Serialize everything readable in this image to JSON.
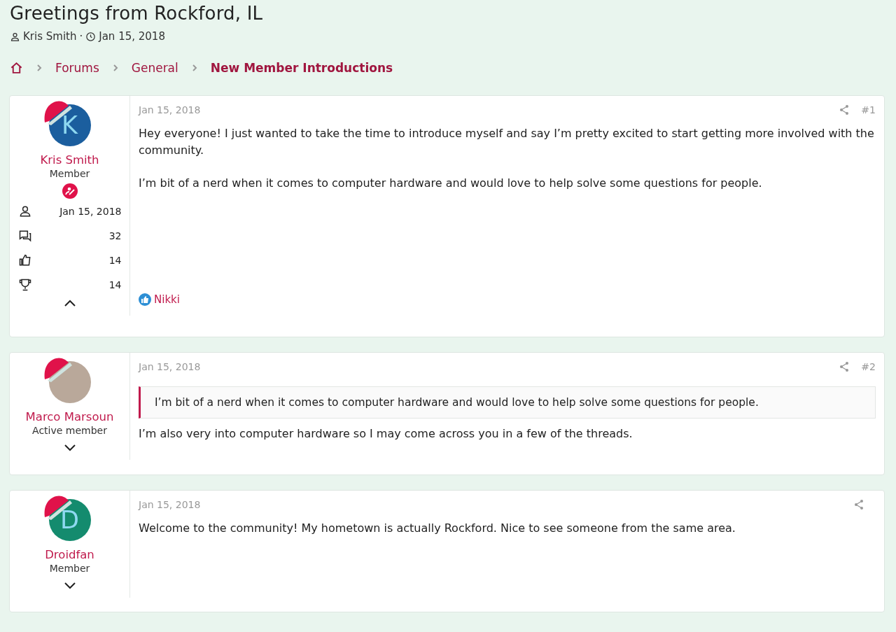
{
  "thread": {
    "title": "Greetings from Rockford, IL",
    "author": "Kris Smith",
    "separator": "·",
    "date": "Jan 15, 2018"
  },
  "breadcrumb": [
    "Forums",
    "General",
    "New Member Introductions"
  ],
  "posts": [
    {
      "user": {
        "name": "Kris Smith",
        "role": "Member",
        "avatar": {
          "kind": "letter",
          "letter": "K",
          "color": "#1b5e9e"
        },
        "badge": true,
        "expanded": true,
        "stats": [
          {
            "kind": "joined",
            "value": "Jan 15, 2018"
          },
          {
            "kind": "messages",
            "value": "32"
          },
          {
            "kind": "reactions",
            "value": "14"
          },
          {
            "kind": "points",
            "value": "14"
          }
        ]
      },
      "date": "Jan 15, 2018",
      "number": "#1",
      "paragraphs": [
        "Hey everyone! I just wanted to take the time to introduce myself and say I’m pretty excited to start getting more involved with the community.",
        "I’m bit of a nerd when it comes to computer hardware and would love to help solve some questions for people."
      ],
      "reactions": [
        "Nikki"
      ]
    },
    {
      "user": {
        "name": "Marco Marsoun",
        "role": "Active member",
        "avatar": {
          "kind": "photo"
        },
        "badge": false,
        "expanded": false
      },
      "date": "Jan 15, 2018",
      "number": "#2",
      "quote": "I’m bit of a nerd when it comes to computer hardware and would love to help solve some questions for people.",
      "paragraphs": [
        "I’m also very into computer hardware so I may come across you in a few of the threads."
      ]
    },
    {
      "user": {
        "name": "Droidfan",
        "role": "Member",
        "avatar": {
          "kind": "letter",
          "letter": "D",
          "color": "#148b6e"
        },
        "badge": false,
        "expanded": false
      },
      "date": "Jan 15, 2018",
      "paragraphs": [
        "Welcome to the community! My hometown is actually Rockford. Nice to see someone from the same area."
      ]
    }
  ]
}
